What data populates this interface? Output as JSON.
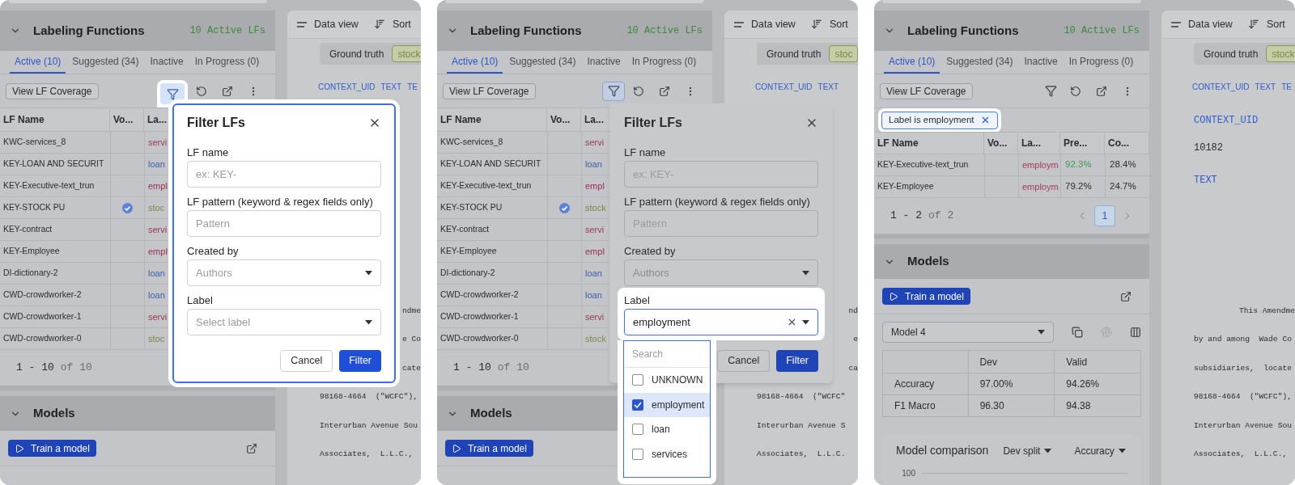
{
  "panels": [
    {
      "lf_panel": {
        "title": "Labeling Functions",
        "count": "10 Active LFs",
        "tabs": [
          {
            "label": "Active (10)",
            "selected": true
          },
          {
            "label": "Suggested (34)",
            "selected": false
          },
          {
            "label": "Inactive",
            "selected": false
          },
          {
            "label": "In Progress (0)",
            "selected": false
          }
        ],
        "coverage_button": "View LF Coverage",
        "filter_active": true,
        "columns": [
          "LF Name",
          "Vo...",
          "La..."
        ],
        "rows": [
          {
            "name": "KWC-services_8",
            "voted": false,
            "label": "servi",
            "color": "#9a3a4c"
          },
          {
            "name": "KEY-LOAN AND SECURIT",
            "voted": false,
            "label": "loan",
            "color": "#3a5fa8"
          },
          {
            "name": "KEY-Executive-text_trun",
            "voted": false,
            "label": "empl",
            "color": "#9a2f55"
          },
          {
            "name": "KEY-STOCK PU",
            "voted": true,
            "label": "stoc",
            "color": "#7b8b45"
          },
          {
            "name": "KEY-contract",
            "voted": false,
            "label": "servi",
            "color": "#9a3a4c"
          },
          {
            "name": "KEY-Employee",
            "voted": false,
            "label": "empl",
            "color": "#9a2f55"
          },
          {
            "name": "DI-dictionary-2",
            "voted": false,
            "label": "loan",
            "color": "#3a5fa8"
          },
          {
            "name": "CWD-crowdworker-2",
            "voted": false,
            "label": "loan",
            "color": "#3a5fa8"
          },
          {
            "name": "CWD-crowdworker-1",
            "voted": false,
            "label": "servi",
            "color": "#9a3a4c"
          },
          {
            "name": "CWD-crowdworker-0",
            "voted": false,
            "label": "stoc",
            "color": "#7b8b45"
          }
        ],
        "range": "1 - 10",
        "total": "of 10"
      },
      "models": {
        "title": "Models",
        "train_button": "Train a model"
      },
      "data_view": {
        "view_label": "Data view",
        "sort_label": "Sort",
        "ground_truth": "Ground truth",
        "ground_truth_value": "stock",
        "headings": [
          "CONTEXT_UID",
          "TEXT",
          "TE"
        ],
        "lines": [
          {
            "kind": "fragment",
            "text": "ndme"
          },
          {
            "kind": "fragment",
            "text": "e Co"
          },
          {
            "kind": "fragment",
            "text": "cate"
          },
          {
            "kind": "line",
            "text": "98168-4664  (\"WCFC\"),"
          },
          {
            "kind": "line",
            "text": "Interurban Avenue Sou"
          },
          {
            "kind": "line",
            "text": "Associates,  L.L.C.,"
          }
        ]
      },
      "dialog": {
        "title": "Filter LFs",
        "focused": true,
        "fields": [
          {
            "kind": "text",
            "label": "LF name",
            "placeholder": "ex: KEY-",
            "highlighted": false
          },
          {
            "kind": "text",
            "label": "LF pattern (keyword & regex fields only)",
            "placeholder": "Pattern",
            "highlighted": false
          },
          {
            "kind": "select",
            "label": "Created by",
            "placeholder": "Authors",
            "highlighted": false
          },
          {
            "kind": "select",
            "label": "Label",
            "placeholder": "Select label",
            "highlighted": false
          }
        ],
        "buttons": [
          {
            "label": "Cancel",
            "primary": false
          },
          {
            "label": "Filter",
            "primary": true
          }
        ]
      }
    },
    {
      "lf_panel": {
        "title": "Labeling Functions",
        "count": "10 Active LFs",
        "tabs": [
          {
            "label": "Active (10)",
            "selected": true
          },
          {
            "label": "Suggested (34)",
            "selected": false
          },
          {
            "label": "Inactive",
            "selected": false
          },
          {
            "label": "In Progress (0)",
            "selected": false
          }
        ],
        "coverage_button": "View LF Coverage",
        "filter_active": true,
        "columns": [
          "LF Name",
          "Vo...",
          "La..."
        ],
        "rows": [
          {
            "name": "KWC-services_8",
            "voted": false,
            "label": "servi",
            "color": "#9a3a4c"
          },
          {
            "name": "KEY-LOAN AND SECURIT",
            "voted": false,
            "label": "loan",
            "color": "#3a5fa8"
          },
          {
            "name": "KEY-Executive-text_trun",
            "voted": false,
            "label": "empl",
            "color": "#9a2f55"
          },
          {
            "name": "KEY-STOCK PU",
            "voted": true,
            "label": "stock",
            "color": "#7b8b45"
          },
          {
            "name": "KEY-contract",
            "voted": false,
            "label": "servi",
            "color": "#9a3a4c"
          },
          {
            "name": "KEY-Employee",
            "voted": false,
            "label": "empl",
            "color": "#9a2f55"
          },
          {
            "name": "DI-dictionary-2",
            "voted": false,
            "label": "loan",
            "color": "#3a5fa8"
          },
          {
            "name": "CWD-crowdworker-2",
            "voted": false,
            "label": "loan",
            "color": "#3a5fa8"
          },
          {
            "name": "CWD-crowdworker-1",
            "voted": false,
            "label": "servi",
            "color": "#9a3a4c"
          },
          {
            "name": "CWD-crowdworker-0",
            "voted": false,
            "label": "stock",
            "color": "#7b8b45"
          }
        ],
        "range": "1 - 10",
        "total": "of 10"
      },
      "models": {
        "title": "Models",
        "train_button": "Train a model"
      },
      "data_view": {
        "view_label": "Data view",
        "sort_label": "Sort",
        "ground_truth": "Ground truth",
        "ground_truth_value": "stoc",
        "headings": [
          "CONTEXT_UID",
          "TEXT"
        ],
        "lines": [
          {
            "kind": "fragment",
            "text": "nd"
          },
          {
            "kind": "fragment",
            "text": "e"
          },
          {
            "kind": "fragment",
            "text": "ca"
          },
          {
            "kind": "line",
            "text": "98168-4664  (\"WCFC\""
          },
          {
            "kind": "line",
            "text": "Interurban Avenue S"
          },
          {
            "kind": "line",
            "text": "Associates,  L.L.C."
          }
        ]
      },
      "dialog": {
        "title": "Filter LFs",
        "focused": false,
        "fields": [
          {
            "kind": "text",
            "label": "LF name",
            "placeholder": "ex: KEY-",
            "highlighted": false
          },
          {
            "kind": "text",
            "label": "LF pattern (keyword & regex fields only)",
            "placeholder": "Pattern",
            "highlighted": false
          },
          {
            "kind": "select",
            "label": "Created by",
            "placeholder": "Authors",
            "highlighted": false
          },
          {
            "kind": "select",
            "label": "Label",
            "value": "employment",
            "highlighted": true,
            "menu": {
              "search_placeholder": "Search",
              "options": [
                {
                  "label": "UNKNOWN",
                  "checked": false
                },
                {
                  "label": "employment",
                  "checked": true
                },
                {
                  "label": "loan",
                  "checked": false
                },
                {
                  "label": "services",
                  "checked": false
                }
              ]
            }
          }
        ],
        "buttons": [
          {
            "label": "Cancel",
            "primary": false
          },
          {
            "label": "Filter",
            "primary": true
          }
        ]
      }
    },
    {
      "lf_panel": {
        "title": "Labeling Functions",
        "count": "10 Active LFs",
        "tabs": [
          {
            "label": "Active (10)",
            "selected": true
          },
          {
            "label": "Suggested (34)",
            "selected": false
          },
          {
            "label": "Inactive",
            "selected": false
          },
          {
            "label": "In Progress (0)",
            "selected": false
          }
        ],
        "coverage_button": "View LF Coverage",
        "filter_active": false,
        "chips": [
          {
            "text": "Label is employment",
            "highlighted": true
          }
        ],
        "columns": [
          "LF Name",
          "Vo...",
          "La...",
          "Pre...",
          "Co..."
        ],
        "rows": [
          {
            "name": "KEY-Executive-text_trun",
            "voted": false,
            "label": "employm",
            "color": "#a23a5c",
            "precision": "92.3%",
            "good": true,
            "coverage": "28.4%"
          },
          {
            "name": "KEY-Employee",
            "voted": false,
            "label": "employm",
            "color": "#a23a5c",
            "precision": "79.2%",
            "good": false,
            "coverage": "24.7%"
          }
        ],
        "range": "1 - 2",
        "total": "of 2",
        "pages": [
          {
            "label": "1",
            "selected": true
          }
        ]
      },
      "models": {
        "title": "Models",
        "train_button": "Train a model",
        "model_select": "Model 4",
        "metrics": {
          "columns": [
            "Dev",
            "Valid"
          ],
          "rows": [
            {
              "name": "Accuracy",
              "values": [
                "97.00%",
                "94.26%"
              ]
            },
            {
              "name": "F1 Macro",
              "values": [
                "96.30",
                "94.38"
              ]
            }
          ]
        },
        "comparison": {
          "title": "Model comparison",
          "split": "Dev split",
          "metric": "Accuracy",
          "y_tick": "100"
        }
      },
      "data_view": {
        "view_label": "Data view",
        "sort_label": "Sort",
        "ground_truth": "Ground truth",
        "ground_truth_value": "stock",
        "headings": [
          "CONTEXT_UID",
          "TEXT",
          "TE"
        ],
        "record": {
          "uid_label": "CONTEXT_UID",
          "uid": "10182",
          "text_label": "TEXT"
        },
        "lines": [
          {
            "kind": "fragment",
            "text": "This Amendme"
          },
          {
            "kind": "line",
            "text": "by and among  Wade Co"
          },
          {
            "kind": "line",
            "text": "subsidiaries,  locate"
          },
          {
            "kind": "line",
            "text": "98168-4664  (\"WCFC\"),"
          },
          {
            "kind": "line",
            "text": "Interurban Avenue Sou"
          },
          {
            "kind": "line",
            "text": "Associates,  L.L.C.,"
          }
        ]
      }
    }
  ]
}
